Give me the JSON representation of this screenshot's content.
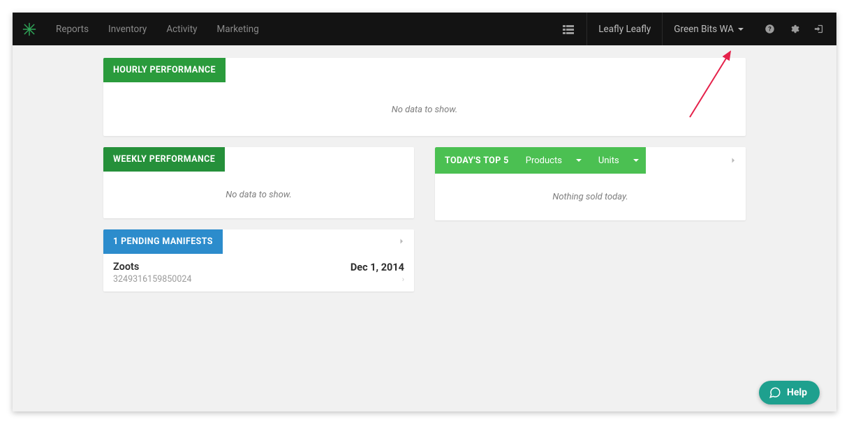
{
  "nav": {
    "links": [
      "Reports",
      "Inventory",
      "Activity",
      "Marketing"
    ],
    "user_label": "Leafly Leafly",
    "location_label": "Green Bits WA"
  },
  "hourly": {
    "title": "HOURLY PERFORMANCE",
    "empty": "No data to show."
  },
  "weekly": {
    "title": "WEEKLY PERFORMANCE",
    "empty": "No data to show."
  },
  "top5": {
    "title": "TODAY'S TOP 5",
    "dropdown1": "Products",
    "dropdown2": "Units",
    "empty": "Nothing sold today."
  },
  "manifests": {
    "title": "1 PENDING MANIFESTS",
    "items": [
      {
        "name": "Zoots",
        "id": "3249316159850024",
        "date": "Dec 1, 2014"
      }
    ]
  },
  "help": {
    "label": "Help"
  },
  "colors": {
    "green_dark": "#2a9b3c",
    "green_light": "#4bc052",
    "blue": "#2c8ccc",
    "teal": "#1ea08e",
    "annotation": "#e5214a"
  }
}
